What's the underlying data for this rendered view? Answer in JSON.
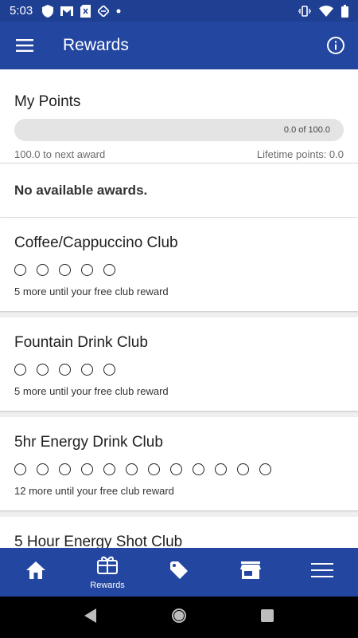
{
  "status_bar": {
    "time": "5:03",
    "left_icons": [
      "shield-icon",
      "gmail-icon",
      "sim-icon",
      "app-icon",
      "dot-icon"
    ],
    "right_icons": [
      "vibrate-icon",
      "wifi-icon",
      "battery-icon"
    ]
  },
  "app_bar": {
    "title": "Rewards",
    "menu_icon": "hamburger-menu-icon",
    "info_icon": "info-icon"
  },
  "points": {
    "title": "My Points",
    "progress_text": "0.0 of 100.0",
    "progress_fraction": 0.0,
    "next_award_text": "100.0 to next award",
    "lifetime_text": "Lifetime points: 0.0"
  },
  "awards": {
    "empty_text": "No available awards."
  },
  "clubs": [
    {
      "title": "Coffee/Cappuccino Club",
      "circles": 5,
      "note": "5 more until your free club reward"
    },
    {
      "title": "Fountain Drink Club",
      "circles": 5,
      "note": "5 more until your free club reward"
    },
    {
      "title": "5hr Energy Drink Club",
      "circles": 12,
      "note": "12 more until your free club reward"
    },
    {
      "title": "5 Hour Energy Shot Club",
      "circles": 0,
      "note": ""
    }
  ],
  "bottom_nav": {
    "items": [
      {
        "icon": "home-icon",
        "label": ""
      },
      {
        "icon": "rewards-gift-icon",
        "label": "Rewards"
      },
      {
        "icon": "tag-icon",
        "label": ""
      },
      {
        "icon": "store-icon",
        "label": ""
      },
      {
        "icon": "menu-icon",
        "label": ""
      }
    ]
  },
  "colors": {
    "primary": "#2346a0",
    "status_bar": "#1f3f93"
  }
}
